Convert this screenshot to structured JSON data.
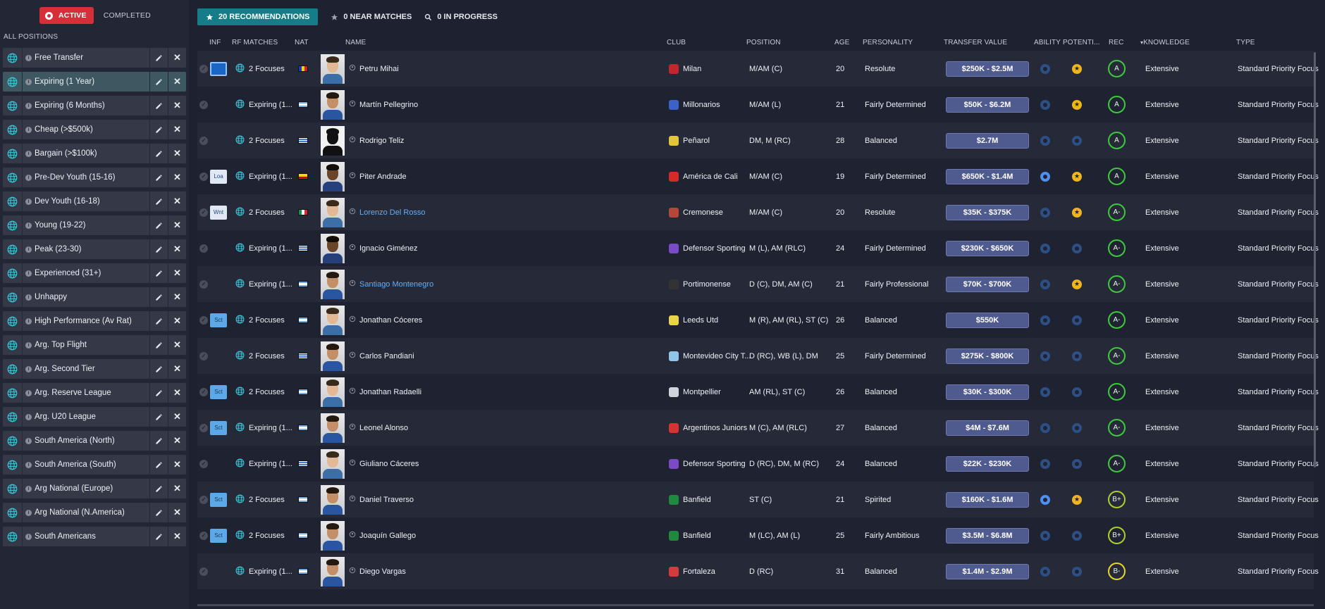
{
  "sidebar": {
    "toggle": {
      "active_label": "ACTIVE",
      "completed_label": "COMPLETED"
    },
    "section_label": "ALL POSITIONS",
    "items": [
      {
        "label": "Free Transfer"
      },
      {
        "label": "Expiring (1 Year)",
        "selected": true
      },
      {
        "label": "Expiring (6 Months)"
      },
      {
        "label": "Cheap (>$500k)"
      },
      {
        "label": "Bargain (>$100k)"
      },
      {
        "label": "Pre-Dev Youth (15-16)"
      },
      {
        "label": "Dev Youth (16-18)"
      },
      {
        "label": "Young (19-22)"
      },
      {
        "label": "Peak (23-30)"
      },
      {
        "label": "Experienced (31+)"
      },
      {
        "label": "Unhappy"
      },
      {
        "label": "High Performance (Av Rat)"
      },
      {
        "label": "Arg. Top Flight"
      },
      {
        "label": "Arg. Second Tier"
      },
      {
        "label": "Arg. Reserve League"
      },
      {
        "label": "Arg. U20 League"
      },
      {
        "label": "South America (North)"
      },
      {
        "label": "South America (South)"
      },
      {
        "label": "Arg National (Europe)"
      },
      {
        "label": "Arg National (N.America)"
      },
      {
        "label": "South Americans"
      }
    ]
  },
  "tabs": {
    "recommendations": "20 RECOMMENDATIONS",
    "near_matches": "0 NEAR MATCHES",
    "in_progress": "0 IN PROGRESS"
  },
  "columns": {
    "inf": "INF",
    "rf_matches": "RF MATCHES",
    "nat": "NAT",
    "name": "NAME",
    "club": "CLUB",
    "position": "POSITION",
    "age": "AGE",
    "personality": "PERSONALITY",
    "transfer_value": "TRANSFER VALUE",
    "ability": "ABILITY",
    "potential": "POTENTI...",
    "rec": "REC",
    "knowledge": "KNOWLEDGE",
    "type": "TYPE"
  },
  "colors": {
    "accent_tab": "#167c87",
    "active_toggle": "#d72f3a",
    "value_pill": "#4f5a8f",
    "link": "#63aef5"
  },
  "rows": [
    {
      "inf": "",
      "inf_style": "blue",
      "rf": "2 Focuses",
      "flag": "romania",
      "photo": "light",
      "name": "Petru Mihai",
      "link": false,
      "club": "Milan",
      "club_color": "#c4242c",
      "position": "M/AM (C)",
      "age": "20",
      "personality": "Resolute",
      "value": "$250K - $2.5M",
      "ability_bright": false,
      "potential_star": true,
      "rec": "A",
      "rec_style": "green",
      "knowledge": "Extensive",
      "type": "Standard Priority Focus"
    },
    {
      "inf": "",
      "inf_style": "none",
      "rf": "Expiring (1...",
      "flag": "argentina",
      "photo": "tan",
      "name": "Martín Pellegrino",
      "link": false,
      "club": "Millonarios",
      "club_color": "#3b62c9",
      "position": "M/AM (L)",
      "age": "21",
      "personality": "Fairly Determined",
      "value": "$50K - $6.2M",
      "ability_bright": false,
      "potential_star": true,
      "rec": "A",
      "rec_style": "green",
      "knowledge": "Extensive",
      "type": "Standard Priority Focus"
    },
    {
      "inf": "",
      "inf_style": "none",
      "rf": "2 Focuses",
      "flag": "uruguay",
      "photo": "silhouette",
      "name": "Rodrigo Teliz",
      "link": false,
      "club": "Peñarol",
      "club_color": "#e3c53a",
      "position": "DM, M (RC)",
      "age": "28",
      "personality": "Balanced",
      "value": "$2.7M",
      "ability_bright": false,
      "potential_star": false,
      "rec": "A",
      "rec_style": "green",
      "knowledge": "Extensive",
      "type": "Standard Priority Focus"
    },
    {
      "inf": "Loa",
      "inf_style": "plain",
      "rf": "Expiring (1...",
      "flag": "colombia",
      "photo": "dark",
      "name": "Piter Andrade",
      "link": false,
      "club": "América de Cali",
      "club_color": "#d42a2a",
      "position": "M/AM (C)",
      "age": "19",
      "personality": "Fairly Determined",
      "value": "$650K - $1.4M",
      "ability_bright": true,
      "potential_star": true,
      "rec": "A",
      "rec_style": "green",
      "knowledge": "Extensive",
      "type": "Standard Priority Focus"
    },
    {
      "inf": "Wnt",
      "inf_style": "plain",
      "rf": "2 Focuses",
      "flag": "italy",
      "photo": "light",
      "name": "Lorenzo Del Rosso",
      "link": true,
      "club": "Cremonese",
      "club_color": "#b5463a",
      "position": "M/AM (C)",
      "age": "20",
      "personality": "Resolute",
      "value": "$35K - $375K",
      "ability_bright": false,
      "potential_star": true,
      "rec": "A-",
      "rec_style": "green",
      "knowledge": "Extensive",
      "type": "Standard Priority Focus"
    },
    {
      "inf": "",
      "inf_style": "none",
      "rf": "Expiring (1...",
      "flag": "uruguay",
      "photo": "dark",
      "name": "Ignacio Giménez",
      "link": false,
      "club": "Defensor Sporting",
      "club_color": "#7b4bc7",
      "position": "M (L), AM (RLC)",
      "age": "24",
      "personality": "Fairly Determined",
      "value": "$230K - $650K",
      "ability_bright": false,
      "potential_star": false,
      "rec": "A-",
      "rec_style": "green",
      "knowledge": "Extensive",
      "type": "Standard Priority Focus"
    },
    {
      "inf": "",
      "inf_style": "none",
      "rf": "Expiring (1...",
      "flag": "argentina",
      "photo": "tan",
      "name": "Santiago Montenegro",
      "link": true,
      "club": "Portimonense",
      "club_color": "#333333",
      "position": "D (C), DM, AM (C)",
      "age": "21",
      "personality": "Fairly Professional",
      "value": "$70K - $700K",
      "ability_bright": false,
      "potential_star": true,
      "rec": "A-",
      "rec_style": "green",
      "knowledge": "Extensive",
      "type": "Standard Priority Focus"
    },
    {
      "inf": "Sct",
      "inf_style": "sct",
      "rf": "2 Focuses",
      "flag": "argentina",
      "photo": "light",
      "name": "Jonathan Cóceres",
      "link": false,
      "club": "Leeds Utd",
      "club_color": "#e9d44a",
      "position": "M (R), AM (RL), ST (C)",
      "age": "26",
      "personality": "Balanced",
      "value": "$550K",
      "ability_bright": false,
      "potential_star": false,
      "rec": "A-",
      "rec_style": "green",
      "knowledge": "Extensive",
      "type": "Standard Priority Focus"
    },
    {
      "inf": "",
      "inf_style": "none",
      "rf": "2 Focuses",
      "flag": "uruguay",
      "photo": "tan",
      "name": "Carlos Pandiani",
      "link": false,
      "club": "Montevideo City T...",
      "club_color": "#8fc6ea",
      "position": "D (RC), WB (L), DM",
      "age": "25",
      "personality": "Fairly Determined",
      "value": "$275K - $800K",
      "ability_bright": false,
      "potential_star": false,
      "rec": "A-",
      "rec_style": "green",
      "knowledge": "Extensive",
      "type": "Standard Priority Focus"
    },
    {
      "inf": "Sct",
      "inf_style": "sct",
      "rf": "2 Focuses",
      "flag": "argentina",
      "photo": "light",
      "name": "Jonathan Radaelli",
      "link": false,
      "club": "Montpellier",
      "club_color": "#cfd3dc",
      "position": "AM (RL), ST (C)",
      "age": "26",
      "personality": "Balanced",
      "value": "$30K - $300K",
      "ability_bright": false,
      "potential_star": false,
      "rec": "A-",
      "rec_style": "green",
      "knowledge": "Extensive",
      "type": "Standard Priority Focus"
    },
    {
      "inf": "Sct",
      "inf_style": "sct",
      "rf": "Expiring (1...",
      "flag": "argentina",
      "photo": "tan",
      "name": "Leonel Alonso",
      "link": false,
      "club": "Argentinos Juniors",
      "club_color": "#d73232",
      "position": "M (C), AM (RLC)",
      "age": "27",
      "personality": "Balanced",
      "value": "$4M - $7.6M",
      "ability_bright": false,
      "potential_star": false,
      "rec": "A-",
      "rec_style": "green",
      "knowledge": "Extensive",
      "type": "Standard Priority Focus"
    },
    {
      "inf": "",
      "inf_style": "none",
      "rf": "Expiring (1...",
      "flag": "uruguay",
      "photo": "light",
      "name": "Giuliano Cáceres",
      "link": false,
      "club": "Defensor Sporting",
      "club_color": "#7b4bc7",
      "position": "D (RC), DM, M (RC)",
      "age": "24",
      "personality": "Balanced",
      "value": "$22K - $230K",
      "ability_bright": false,
      "potential_star": false,
      "rec": "A-",
      "rec_style": "green",
      "knowledge": "Extensive",
      "type": "Standard Priority Focus"
    },
    {
      "inf": "Sct",
      "inf_style": "sct",
      "rf": "2 Focuses",
      "flag": "argentina",
      "photo": "tan",
      "name": "Daniel Traverso",
      "link": false,
      "club": "Banfield",
      "club_color": "#1f8a3e",
      "position": "ST (C)",
      "age": "21",
      "personality": "Spirited",
      "value": "$160K - $1.6M",
      "ability_bright": true,
      "potential_star": true,
      "rec": "B+",
      "rec_style": "lime",
      "knowledge": "Extensive",
      "type": "Standard Priority Focus"
    },
    {
      "inf": "Sct",
      "inf_style": "sct",
      "rf": "2 Focuses",
      "flag": "argentina",
      "photo": "tan",
      "name": "Joaquín Gallego",
      "link": false,
      "club": "Banfield",
      "club_color": "#1f8a3e",
      "position": "M (LC), AM (L)",
      "age": "25",
      "personality": "Fairly Ambitious",
      "value": "$3.5M - $6.8M",
      "ability_bright": false,
      "potential_star": false,
      "rec": "B+",
      "rec_style": "lime",
      "knowledge": "Extensive",
      "type": "Standard Priority Focus"
    },
    {
      "inf": "",
      "inf_style": "none",
      "rf": "Expiring (1...",
      "flag": "argentina",
      "photo": "tan",
      "name": "Diego Vargas",
      "link": false,
      "club": "Fortaleza",
      "club_color": "#d63b3b",
      "position": "D (RC)",
      "age": "31",
      "personality": "Balanced",
      "value": "$1.4M - $2.9M",
      "ability_bright": false,
      "potential_star": false,
      "rec": "B-",
      "rec_style": "yellow",
      "knowledge": "Extensive",
      "type": "Standard Priority Focus"
    }
  ]
}
